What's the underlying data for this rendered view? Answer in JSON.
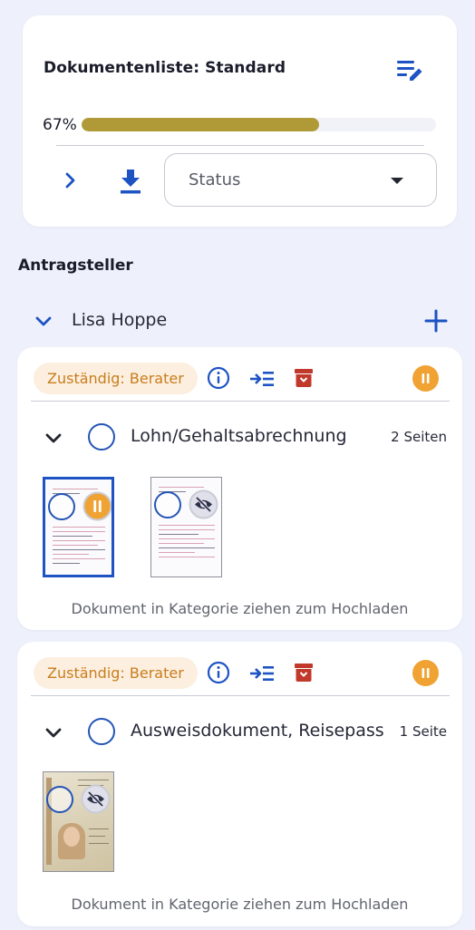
{
  "list": {
    "title": "Dokumentenliste: Standard",
    "progress_label": "67%",
    "progress": 0.67,
    "status_placeholder": "Status"
  },
  "section": {
    "title": "Antragsteller"
  },
  "person": {
    "name": "Lisa Hoppe"
  },
  "documents": [
    {
      "badge": "Zuständig: Berater",
      "title": "Lohn/Gehaltsabrechnung",
      "pages": "2 Seiten",
      "hint": "Dokument in Kategorie ziehen zum Hochladen",
      "thumbnails": [
        {
          "kind": "payslip",
          "status": "pause-icon",
          "selected": true
        },
        {
          "kind": "payslip",
          "status": "hidden-eye-icon",
          "selected": false
        }
      ]
    },
    {
      "badge": "Zuständig: Berater",
      "title": "Ausweisdokument, Reisepass",
      "pages": "1 Seite",
      "hint": "Dokument in Kategorie ziehen zum Hochladen",
      "thumbnails": [
        {
          "kind": "passport",
          "status": "hidden-eye-icon",
          "selected": false
        }
      ]
    }
  ],
  "colors": {
    "accent": "#1d53c3",
    "progress": "#b09a38",
    "badge_bg": "#fcefe0",
    "badge_text": "#c97d1c",
    "pause": "#f0a233",
    "archive": "#c0392b",
    "background": "#eef1fb"
  },
  "icons": {
    "edit_list": "edit-list-icon",
    "expand": "chevron-right-icon",
    "download": "download-icon",
    "dropdown": "caret-down-icon",
    "collapse": "chevron-down-icon",
    "add": "plus-icon",
    "info": "info-icon",
    "move": "move-to-list-icon",
    "archive": "archive-icon",
    "pause": "pause-icon"
  }
}
